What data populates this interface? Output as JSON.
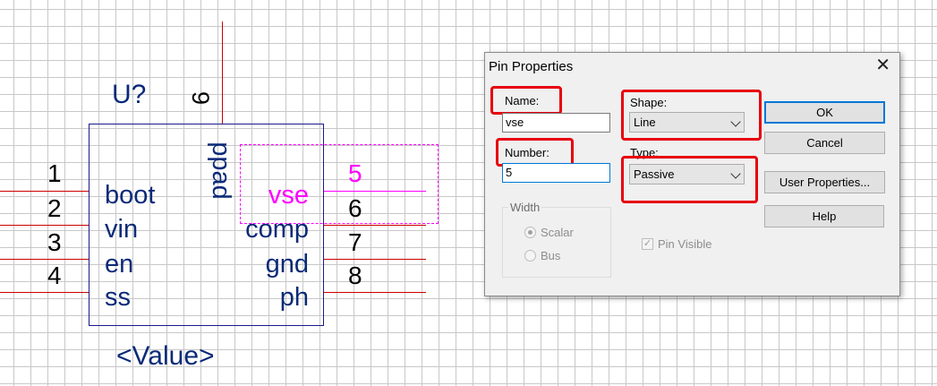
{
  "schematic": {
    "ref": "U?",
    "value": "<Value>",
    "top_pin_number": "9",
    "top_pin_label": "ppad",
    "left_pins": [
      {
        "number": "1",
        "label": "boot"
      },
      {
        "number": "2",
        "label": "vin"
      },
      {
        "number": "3",
        "label": "en"
      },
      {
        "number": "4",
        "label": "ss"
      }
    ],
    "right_pins": [
      {
        "number": "5",
        "label": "vse"
      },
      {
        "number": "6",
        "label": "comp"
      },
      {
        "number": "7",
        "label": "gnd"
      },
      {
        "number": "8",
        "label": "ph"
      }
    ],
    "colors": {
      "text": "#0a2a78",
      "selected": "#ff00ff",
      "wire": "#cc0000",
      "body_border": "#1a1a8c"
    }
  },
  "dialog": {
    "title": "Pin Properties",
    "close_glyph": "✕",
    "name_label": "Name:",
    "name_value": "vse",
    "number_label": "Number:",
    "number_value": "5",
    "shape_label": "Shape:",
    "shape_value": "Line",
    "type_label": "Type:",
    "type_value": "Passive",
    "width_label": "Width",
    "scalar_label": "Scalar",
    "bus_label": "Bus",
    "pin_visible_label": "Pin Visible",
    "buttons": {
      "ok": "OK",
      "cancel": "Cancel",
      "user_properties": "User Properties...",
      "help": "Help"
    },
    "highlight_color": "#e8000e"
  }
}
